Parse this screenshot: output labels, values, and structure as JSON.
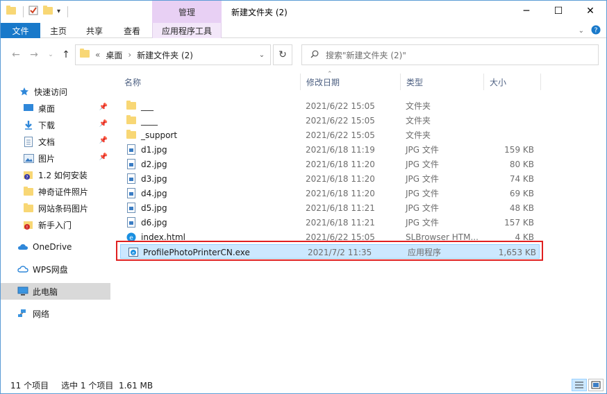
{
  "window": {
    "title": "新建文件夹 (2)",
    "context_tab_header": "管理",
    "controls": {
      "minimize": "─",
      "maximize": "☐",
      "close": "✕"
    }
  },
  "ribbon": {
    "tabs": [
      {
        "label": "文件"
      },
      {
        "label": "主页"
      },
      {
        "label": "共享"
      },
      {
        "label": "查看"
      },
      {
        "label": "应用程序工具"
      }
    ]
  },
  "address": {
    "overflow": "«",
    "crumbs": [
      "桌面",
      "新建文件夹 (2)"
    ],
    "separator": "›"
  },
  "search": {
    "placeholder": "搜索\"新建文件夹 (2)\""
  },
  "sidebar": {
    "items": [
      {
        "label": "快速访问",
        "icon": "star-icon"
      },
      {
        "label": "桌面",
        "icon": "desktop-icon",
        "pinned": true
      },
      {
        "label": "下载",
        "icon": "download-icon",
        "pinned": true
      },
      {
        "label": "文档",
        "icon": "document-icon",
        "pinned": true
      },
      {
        "label": "图片",
        "icon": "picture-icon",
        "pinned": true
      },
      {
        "label": "1.2 如何安装",
        "icon": "folder-badge-icon"
      },
      {
        "label": "神奇证件照片",
        "icon": "folder-icon"
      },
      {
        "label": "网站条码图片",
        "icon": "folder-icon"
      },
      {
        "label": "新手入门",
        "icon": "folder-badge-icon"
      },
      {
        "label": "OneDrive",
        "icon": "cloud-icon"
      },
      {
        "label": "WPS网盘",
        "icon": "wps-cloud-icon"
      },
      {
        "label": "此电脑",
        "icon": "computer-icon",
        "selected": true
      },
      {
        "label": "网络",
        "icon": "network-icon"
      }
    ]
  },
  "columns": [
    {
      "label": "名称"
    },
    {
      "label": "修改日期"
    },
    {
      "label": "类型"
    },
    {
      "label": "大小"
    }
  ],
  "files": [
    {
      "name": "___",
      "date": "2021/6/22 15:05",
      "type": "文件夹",
      "size": "",
      "icon": "folder-icon"
    },
    {
      "name": "____",
      "date": "2021/6/22 15:05",
      "type": "文件夹",
      "size": "",
      "icon": "folder-icon"
    },
    {
      "name": "_support",
      "date": "2021/6/22 15:05",
      "type": "文件夹",
      "size": "",
      "icon": "folder-icon"
    },
    {
      "name": "d1.jpg",
      "date": "2021/6/18 11:19",
      "type": "JPG 文件",
      "size": "159 KB",
      "icon": "jpg-file-icon"
    },
    {
      "name": "d2.jpg",
      "date": "2021/6/18 11:20",
      "type": "JPG 文件",
      "size": "80 KB",
      "icon": "jpg-file-icon"
    },
    {
      "name": "d3.jpg",
      "date": "2021/6/18 11:20",
      "type": "JPG 文件",
      "size": "74 KB",
      "icon": "jpg-file-icon"
    },
    {
      "name": "d4.jpg",
      "date": "2021/6/18 11:20",
      "type": "JPG 文件",
      "size": "69 KB",
      "icon": "jpg-file-icon"
    },
    {
      "name": "d5.jpg",
      "date": "2021/6/18 11:21",
      "type": "JPG 文件",
      "size": "48 KB",
      "icon": "jpg-file-icon"
    },
    {
      "name": "d6.jpg",
      "date": "2021/6/18 11:21",
      "type": "JPG 文件",
      "size": "157 KB",
      "icon": "jpg-file-icon"
    },
    {
      "name": "index.html",
      "date": "2021/6/22 15:05",
      "type": "SLBrowser HTM...",
      "size": "4 KB",
      "icon": "html-file-icon"
    },
    {
      "name": "ProfilePhotoPrinterCN.exe",
      "date": "2021/7/2 11:35",
      "type": "应用程序",
      "size": "1,653 KB",
      "icon": "exe-file-icon",
      "selected": true
    }
  ],
  "status": {
    "item_count": "11 个项目",
    "selection": "选中 1 个项目  1.61 MB"
  }
}
